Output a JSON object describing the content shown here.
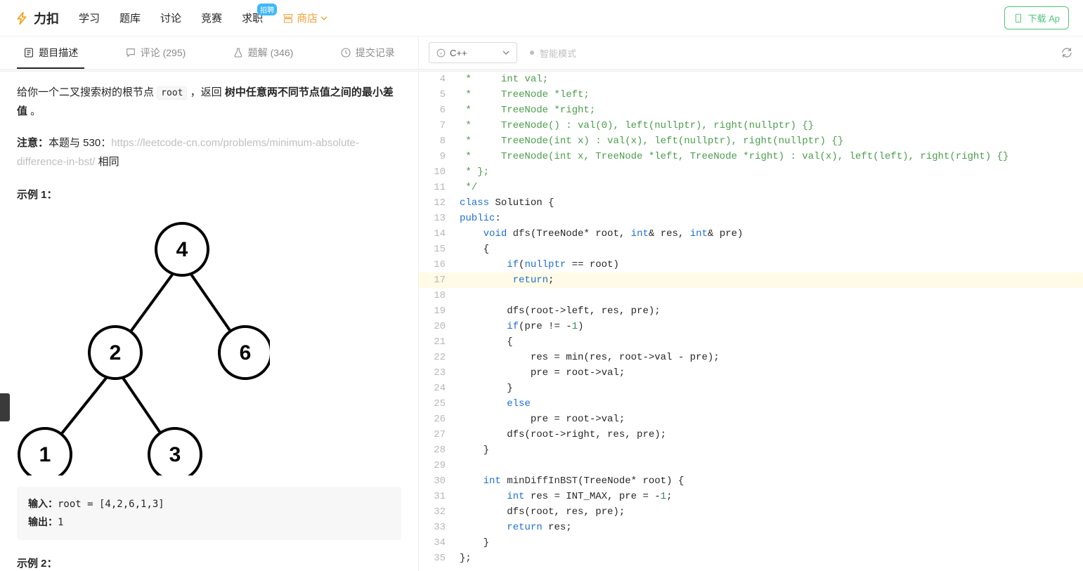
{
  "brand": "力扣",
  "nav": {
    "learn": "学习",
    "problems": "题库",
    "discuss": "讨论",
    "contest": "竞赛",
    "jobs": "求职",
    "jobs_badge": "招聘",
    "store": "商店"
  },
  "download": "下载 Ap",
  "tabs": {
    "desc": "题目描述",
    "comments": "评论 (295)",
    "solutions": "题解 (346)",
    "submissions": "提交记录"
  },
  "lang": "C++",
  "smart": "智能模式",
  "problem": {
    "intro_a": "给你一个二叉搜索树的根节点 ",
    "intro_code": "root",
    "intro_b": " ，返回 ",
    "intro_bold": "树中任意两不同节点值之间的最小差值",
    "intro_c": " 。",
    "note_label": "注意：",
    "note_a": "本题与 530：",
    "note_link": "https://leetcode-cn.com/problems/minimum-absolute-difference-in-bst/",
    "note_b": " 相同",
    "ex1_title": "示例 1：",
    "ex1_in_label": "输入：",
    "ex1_in": "root = [4,2,6,1,3]",
    "ex1_out_label": "输出：",
    "ex1_out": "1",
    "ex2_title": "示例 2："
  },
  "code_lines": [
    {
      "n": 4,
      "html": " <span class='c-comment'>*     int val;</span>"
    },
    {
      "n": 5,
      "html": " <span class='c-comment'>*     TreeNode *left;</span>"
    },
    {
      "n": 6,
      "html": " <span class='c-comment'>*     TreeNode *right;</span>"
    },
    {
      "n": 7,
      "html": " <span class='c-comment'>*     TreeNode() : val(0), left(nullptr), right(nullptr) {}</span>"
    },
    {
      "n": 8,
      "html": " <span class='c-comment'>*     TreeNode(int x) : val(x), left(nullptr), right(nullptr) {}</span>"
    },
    {
      "n": 9,
      "html": " <span class='c-comment'>*     TreeNode(int x, TreeNode *left, TreeNode *right) : val(x), left(left), right(right) {}</span>"
    },
    {
      "n": 10,
      "html": " <span class='c-comment'>* };</span>"
    },
    {
      "n": 11,
      "html": " <span class='c-comment'>*/</span>"
    },
    {
      "n": 12,
      "html": "<span class='c-kw'>class</span> Solution {"
    },
    {
      "n": 13,
      "html": "<span class='c-kw'>public</span>:"
    },
    {
      "n": 14,
      "html": "    <span class='c-kw'>void</span> <span class='c-fn'>dfs</span>(TreeNode* root, <span class='c-kw'>int</span>&amp; res, <span class='c-kw'>int</span>&amp; pre)"
    },
    {
      "n": 15,
      "html": "    {"
    },
    {
      "n": 16,
      "html": "        <span class='c-kw'>if</span>(<span class='c-kw'>nullptr</span> == root)"
    },
    {
      "n": 17,
      "hl": true,
      "html": "         <span class='c-kw'>return</span>;"
    },
    {
      "n": 18,
      "html": "        "
    },
    {
      "n": 19,
      "html": "        dfs(root-&gt;left, res, pre);"
    },
    {
      "n": 20,
      "html": "        <span class='c-kw'>if</span>(pre != -<span class='c-num'>1</span>)"
    },
    {
      "n": 21,
      "html": "        {"
    },
    {
      "n": 22,
      "html": "            res = min(res, root-&gt;val - pre);"
    },
    {
      "n": 23,
      "html": "            pre = root-&gt;val;"
    },
    {
      "n": 24,
      "html": "        }"
    },
    {
      "n": 25,
      "html": "        <span class='c-kw'>else</span>"
    },
    {
      "n": 26,
      "html": "            pre = root-&gt;val;"
    },
    {
      "n": 27,
      "html": "        dfs(root-&gt;right, res, pre);"
    },
    {
      "n": 28,
      "html": "    }"
    },
    {
      "n": 29,
      "html": ""
    },
    {
      "n": 30,
      "html": "    <span class='c-kw'>int</span> <span class='c-fn'>minDiffInBST</span>(TreeNode* root) {"
    },
    {
      "n": 31,
      "html": "        <span class='c-kw'>int</span> res = INT_MAX, pre = -<span class='c-num'>1</span>;"
    },
    {
      "n": 32,
      "html": "        dfs(root, res, pre);"
    },
    {
      "n": 33,
      "html": "        <span class='c-kw'>return</span> res;"
    },
    {
      "n": 34,
      "html": "    }"
    },
    {
      "n": 35,
      "html": "};"
    }
  ]
}
